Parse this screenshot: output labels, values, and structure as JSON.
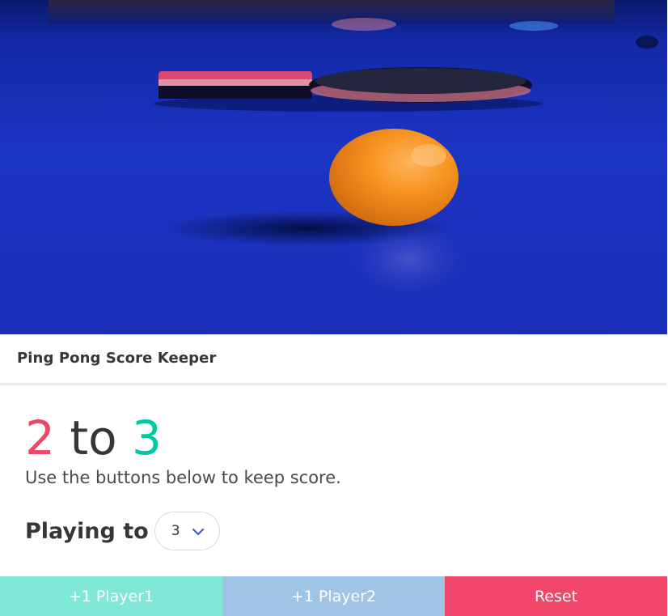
{
  "header": {
    "title": "Ping Pong Score Keeper"
  },
  "score": {
    "player1": "2",
    "separator": "to",
    "player2": "3"
  },
  "helper_text": "Use the buttons below to keep score.",
  "playing_to": {
    "label": "Playing to",
    "selected": "3"
  },
  "buttons": {
    "player1": "+1 Player1",
    "player2": "+1 Player2",
    "reset": "Reset"
  },
  "colors": {
    "player1": "#f0466a",
    "player2": "#00c9a7",
    "button_player1": "#7fe8d6",
    "button_player2": "#9fc4e6",
    "button_reset": "#f0466a"
  },
  "icons": {
    "select_arrow": "chevron-down-icon"
  }
}
